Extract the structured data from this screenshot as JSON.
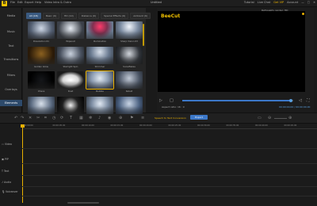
{
  "titlebar": {
    "logo": "B",
    "menus": [
      "File",
      "Edit",
      "Export",
      "Help",
      "Video Intro & Outro"
    ],
    "title": "Untitled",
    "right": [
      "Tutorial",
      "Live Chat",
      "Get VIP",
      "Account"
    ]
  },
  "nav": [
    "Media",
    "Music",
    "Text",
    "Transitions",
    "Filters",
    "Overlays",
    "Elements"
  ],
  "media_tabs": [
    "All (18)",
    "Basic (9)",
    "HD (10)",
    "Distance (9)",
    "Special Effects (6)",
    "Ambient (6)"
  ],
  "thumbs": [
    {
      "label": "Dissolution 01"
    },
    {
      "label": "Wipeout"
    },
    {
      "label": "Illumination"
    },
    {
      "label": "Sharp Vision 03"
    },
    {
      "label": "Golden Glow"
    },
    {
      "label": "Starlight Spin"
    },
    {
      "label": "Shimmer"
    },
    {
      "label": "Snowflakes"
    },
    {
      "label": "Chaos"
    },
    {
      "label": "Dust"
    },
    {
      "label": "Bubble"
    },
    {
      "label": "Kaleid"
    },
    {
      "label": ""
    },
    {
      "label": ""
    },
    {
      "label": ""
    },
    {
      "label": ""
    }
  ],
  "preview": {
    "top_label": "Ref/quality render: HD",
    "brand": "BeeCut",
    "aspect": "Aspect ratio: 16 : 9",
    "timecode": "00:00:00.00 / 00:00:00.00",
    "progress": 0.98
  },
  "toolbar": {
    "speech": "Speech to Text Conversion",
    "export": "Export"
  },
  "timeline": {
    "ticks": [
      "00:00:00",
      "00:00:05.00",
      "00:00:10.00",
      "00:00:15.00",
      "00:00:20.00",
      "00:00:25.00",
      "00:00:30.00",
      "00:00:35.00",
      "00:00:40.00",
      "00:00:45.00"
    ],
    "tracks": [
      "Video",
      "PIP",
      "Text",
      "Audio",
      "Voiceover"
    ]
  },
  "colors": {
    "accent": "#f2c200",
    "blue": "#3c78c8"
  }
}
